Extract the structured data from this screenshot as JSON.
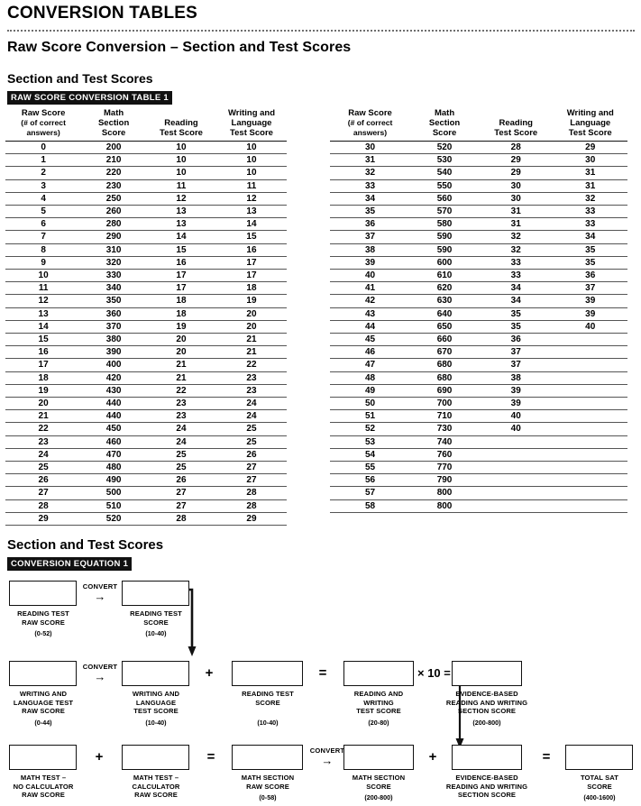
{
  "document": {
    "title": "CONVERSION TABLES",
    "section_title": "Raw Score Conversion – Section and Test Scores",
    "subsection_title": "Section and Test Scores",
    "table_badge": "RAW SCORE CONVERSION TABLE 1",
    "equation_section_title": "Section and Test Scores",
    "equation_badge": "CONVERSION EQUATION 1"
  },
  "table": {
    "headers": {
      "raw_score_line1": "Raw Score",
      "raw_score_line2": "(# of correct",
      "raw_score_line3": "answers)",
      "math_line1": "Math",
      "math_line2": "Section",
      "math_line3": "Score",
      "reading_line1": "Reading",
      "reading_line2": "Test Score",
      "writing_line1": "Writing and",
      "writing_line2": "Language",
      "writing_line3": "Test Score"
    },
    "left_rows": [
      [
        "0",
        "200",
        "10",
        "10"
      ],
      [
        "1",
        "210",
        "10",
        "10"
      ],
      [
        "2",
        "220",
        "10",
        "10"
      ],
      [
        "3",
        "230",
        "11",
        "11"
      ],
      [
        "4",
        "250",
        "12",
        "12"
      ],
      [
        "5",
        "260",
        "13",
        "13"
      ],
      [
        "6",
        "280",
        "13",
        "14"
      ],
      [
        "7",
        "290",
        "14",
        "15"
      ],
      [
        "8",
        "310",
        "15",
        "16"
      ],
      [
        "9",
        "320",
        "16",
        "17"
      ],
      [
        "10",
        "330",
        "17",
        "17"
      ],
      [
        "11",
        "340",
        "17",
        "18"
      ],
      [
        "12",
        "350",
        "18",
        "19"
      ],
      [
        "13",
        "360",
        "18",
        "20"
      ],
      [
        "14",
        "370",
        "19",
        "20"
      ],
      [
        "15",
        "380",
        "20",
        "21"
      ],
      [
        "16",
        "390",
        "20",
        "21"
      ],
      [
        "17",
        "400",
        "21",
        "22"
      ],
      [
        "18",
        "420",
        "21",
        "23"
      ],
      [
        "19",
        "430",
        "22",
        "23"
      ],
      [
        "20",
        "440",
        "23",
        "24"
      ],
      [
        "21",
        "440",
        "23",
        "24"
      ],
      [
        "22",
        "450",
        "24",
        "25"
      ],
      [
        "23",
        "460",
        "24",
        "25"
      ],
      [
        "24",
        "470",
        "25",
        "26"
      ],
      [
        "25",
        "480",
        "25",
        "27"
      ],
      [
        "26",
        "490",
        "26",
        "27"
      ],
      [
        "27",
        "500",
        "27",
        "28"
      ],
      [
        "28",
        "510",
        "27",
        "28"
      ],
      [
        "29",
        "520",
        "28",
        "29"
      ]
    ],
    "right_rows": [
      [
        "30",
        "520",
        "28",
        "29"
      ],
      [
        "31",
        "530",
        "29",
        "30"
      ],
      [
        "32",
        "540",
        "29",
        "31"
      ],
      [
        "33",
        "550",
        "30",
        "31"
      ],
      [
        "34",
        "560",
        "30",
        "32"
      ],
      [
        "35",
        "570",
        "31",
        "33"
      ],
      [
        "36",
        "580",
        "31",
        "33"
      ],
      [
        "37",
        "590",
        "32",
        "34"
      ],
      [
        "38",
        "590",
        "32",
        "35"
      ],
      [
        "39",
        "600",
        "33",
        "35"
      ],
      [
        "40",
        "610",
        "33",
        "36"
      ],
      [
        "41",
        "620",
        "34",
        "37"
      ],
      [
        "42",
        "630",
        "34",
        "39"
      ],
      [
        "43",
        "640",
        "35",
        "39"
      ],
      [
        "44",
        "650",
        "35",
        "40"
      ],
      [
        "45",
        "660",
        "36",
        ""
      ],
      [
        "46",
        "670",
        "37",
        ""
      ],
      [
        "47",
        "680",
        "37",
        ""
      ],
      [
        "48",
        "680",
        "38",
        ""
      ],
      [
        "49",
        "690",
        "39",
        ""
      ],
      [
        "50",
        "700",
        "39",
        ""
      ],
      [
        "51",
        "710",
        "40",
        ""
      ],
      [
        "52",
        "730",
        "40",
        ""
      ],
      [
        "53",
        "740",
        "",
        ""
      ],
      [
        "54",
        "760",
        "",
        ""
      ],
      [
        "55",
        "770",
        "",
        ""
      ],
      [
        "56",
        "790",
        "",
        ""
      ],
      [
        "57",
        "800",
        "",
        ""
      ],
      [
        "58",
        "800",
        "",
        ""
      ]
    ]
  },
  "equation": {
    "boxes": {
      "reading_raw": {
        "label": "READING TEST\nRAW SCORE",
        "range": "(0-52)"
      },
      "reading_test": {
        "label": "READING TEST\nSCORE",
        "range": "(10-40)"
      },
      "writing_raw": {
        "label": "WRITING AND\nLANGUAGE TEST\nRAW SCORE",
        "range": "(0-44)"
      },
      "writing_test": {
        "label": "WRITING AND\nLANGUAGE\nTEST SCORE",
        "range": "(10-40)"
      },
      "reading_test_2": {
        "label": "READING TEST\nSCORE",
        "range": "(10-40)"
      },
      "rw_test": {
        "label": "READING AND\nWRITING\nTEST SCORE",
        "range": "(20-80)"
      },
      "ebrw_section": {
        "label": "EVIDENCE-BASED\nREADING AND WRITING\nSECTION SCORE",
        "range": "(200-800)"
      },
      "math_nocalc": {
        "label": "MATH TEST –\nNO CALCULATOR\nRAW SCORE",
        "range": ""
      },
      "math_calc": {
        "label": "MATH TEST –\nCALCULATOR\nRAW SCORE",
        "range": ""
      },
      "math_raw": {
        "label": "MATH SECTION\nRAW SCORE",
        "range": "(0-58)"
      },
      "math_section": {
        "label": "MATH SECTION\nSCORE",
        "range": "(200-800)"
      },
      "ebrw_section_2": {
        "label": "EVIDENCE-BASED\nREADING AND WRITING\nSECTION SCORE",
        "range": ""
      },
      "total_sat": {
        "label": "TOTAL SAT\nSCORE",
        "range": "(400-1600)"
      }
    },
    "operators": {
      "convert": "CONVERT",
      "convert_arrow": "→",
      "plus": "+",
      "equals": "=",
      "times_ten": "× 10 ="
    }
  }
}
